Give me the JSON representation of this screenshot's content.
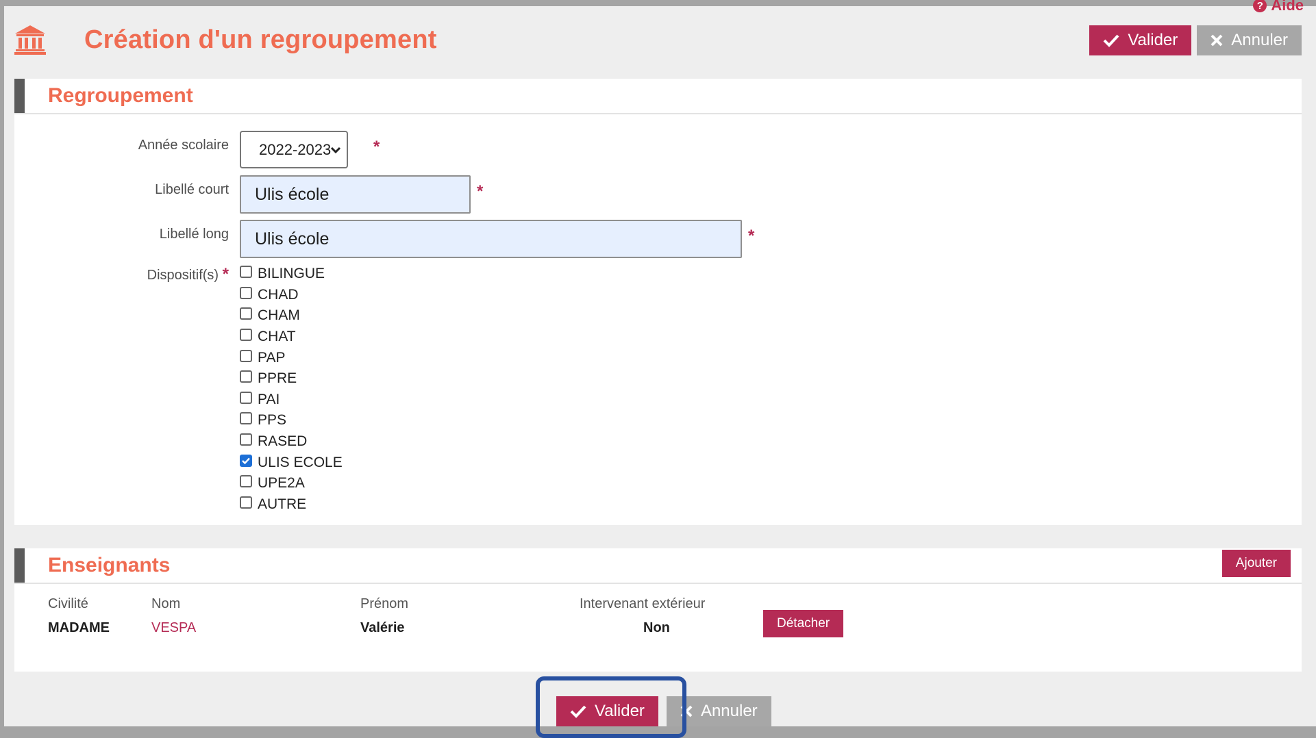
{
  "header": {
    "title": "Création d'un regroupement",
    "help_label": "Aide",
    "validate_label": "Valider",
    "cancel_label": "Annuler"
  },
  "regroupement": {
    "section_title": "Regroupement",
    "annee": {
      "label": "Année scolaire",
      "value": "2022-2023"
    },
    "libelle_court": {
      "label": "Libellé court",
      "value": "Ulis école"
    },
    "libelle_long": {
      "label": "Libellé long",
      "value": "Ulis école"
    },
    "dispositifs": {
      "label": "Dispositif(s)",
      "items": [
        {
          "label": "BILINGUE",
          "checked": false
        },
        {
          "label": "CHAD",
          "checked": false
        },
        {
          "label": "CHAM",
          "checked": false
        },
        {
          "label": "CHAT",
          "checked": false
        },
        {
          "label": "PAP",
          "checked": false
        },
        {
          "label": "PPRE",
          "checked": false
        },
        {
          "label": "PAI",
          "checked": false
        },
        {
          "label": "PPS",
          "checked": false
        },
        {
          "label": "RASED",
          "checked": false
        },
        {
          "label": "ULIS ECOLE",
          "checked": true
        },
        {
          "label": "UPE2A",
          "checked": false
        },
        {
          "label": "AUTRE",
          "checked": false
        }
      ]
    },
    "required_mark": "*"
  },
  "enseignants": {
    "section_title": "Enseignants",
    "add_label": "Ajouter",
    "columns": [
      "Civilité",
      "Nom",
      "Prénom",
      "Intervenant extérieur"
    ],
    "rows": [
      {
        "civilite": "MADAME",
        "nom": "VESPA",
        "prenom": "Valérie",
        "exterieur": "Non",
        "detach_label": "Détacher"
      }
    ]
  },
  "footer": {
    "validate_label": "Valider",
    "cancel_label": "Annuler"
  },
  "colors": {
    "accent": "#ef6c52",
    "primary_button": "#b52b55",
    "secondary_button": "#a7a7a7",
    "focus_ring": "#2850a0"
  }
}
